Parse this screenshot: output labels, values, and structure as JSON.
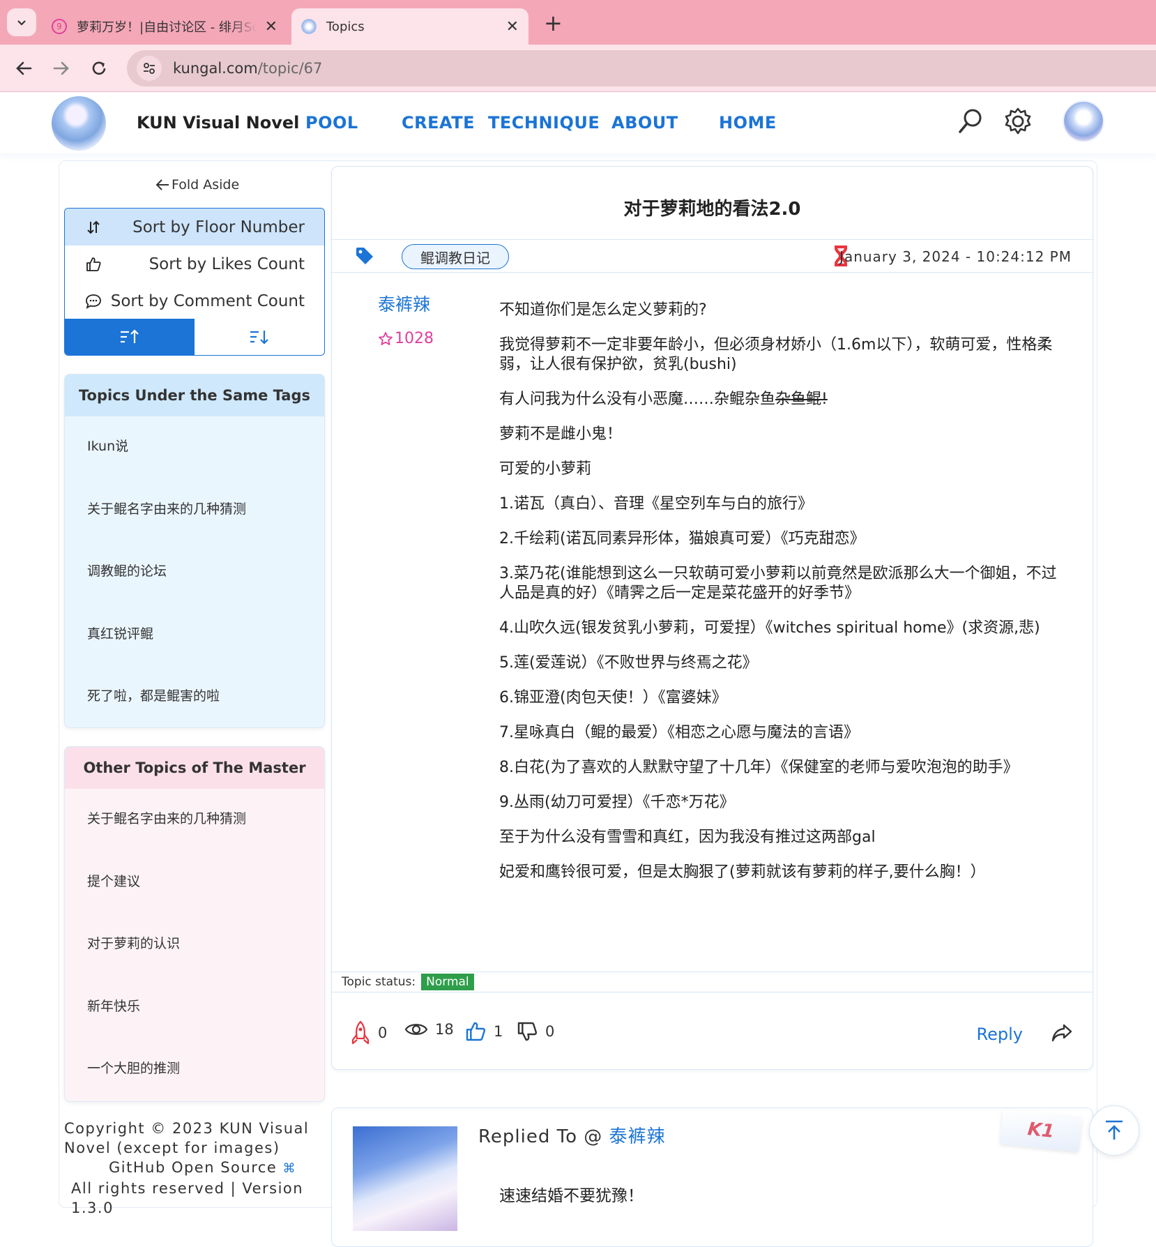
{
  "browser": {
    "tabs": [
      {
        "title": "萝莉万岁！|自由讨论区 - 绯月Sc",
        "favicon": "pink-circle-icon",
        "active": false
      },
      {
        "title": "Topics",
        "favicon": "kun-icon",
        "active": true
      }
    ],
    "url_host": "kungal.com",
    "url_path": "/topic/67"
  },
  "header": {
    "brand": "KUN Visual Novel",
    "menu": [
      "POOL",
      "CREATE",
      "TECHNIQUE",
      "ABOUT",
      "HOME"
    ]
  },
  "aside": {
    "fold_label": "Fold Aside",
    "sort_options": [
      {
        "label": "Sort by Floor Number",
        "icon": "sort-arrows-icon",
        "selected": true
      },
      {
        "label": "Sort by Likes Count",
        "icon": "thumbs-up-icon",
        "selected": false
      },
      {
        "label": "Sort by Comment Count",
        "icon": "comment-icon",
        "selected": false
      }
    ],
    "same_tags": {
      "title": "Topics Under the Same Tags",
      "items": [
        "Ikun说",
        "关于鲲名字由来的几种猜测",
        "调教鲲的论坛",
        "真红锐评鲲",
        "死了啦，都是鲲害的啦"
      ]
    },
    "master": {
      "title": "Other Topics of The Master",
      "items": [
        "关于鲲名字由来的几种猜测",
        "提个建议",
        "对于萝莉的认识",
        "新年快乐",
        "一个大胆的推测"
      ]
    },
    "copyright": {
      "line1": "Copyright © 2023 KUN Visual Novel (except for images)",
      "line2": "GitHub Open Source",
      "line3": "All rights reserved | Version 1.3.0"
    }
  },
  "topic": {
    "title": "对于萝莉地的看法2.0",
    "tag": "鲲调教日记",
    "time": "January 3, 2024 - 10:24:12 PM",
    "author": "泰裤辣",
    "moemoepoint": "1028",
    "paragraphs": [
      "不知道你们是怎么定义萝莉的?",
      "我觉得萝莉不一定非要年龄小，但必须身材娇小（1.6m以下），软萌可爱，性格柔弱，让人很有保护欲，贫乳(bushi)",
      "有人问我为什么没有小恶魔……杂鲲杂鱼",
      "萝莉不是雌小鬼！",
      "可爱的小萝莉",
      "1.诺瓦（真白）、音理《星空列车与白的旅行》",
      "2.千绘莉(诺瓦同素异形体，猫娘真可爱）《巧克甜恋》",
      "3.菜乃花(谁能想到这么一只软萌可爱小萝莉以前竟然是欧派那么大一个御姐，不过人品是真的好）《晴霁之后一定是菜花盛开的好季节》",
      "4.山吹久远(银发贫乳小萝莉，可爱捏）《witches spiritual home》(求资源,悲)",
      "5.莲(爱莲说）《不败世界与终焉之花》",
      "6.锦亚澄(肉包天使！）《富婆妹》",
      "7.星咏真白（鲲的最爱）《相恋之心愿与魔法的言语》",
      "8.白花(为了喜欢的人默默守望了十几年）《保健室的老师与爱吹泡泡的助手》",
      "9.丛雨(幼刀可爱捏）《千恋*万花》",
      "至于为什么没有雪雪和真红，因为我没有推过这两部gal",
      "妃爱和鹰铃很可爱，但是太胸狠了(萝莉就该有萝莉的样子,要什么胸！）"
    ],
    "strike_text": "杂鱼鲲!",
    "status_label": "Topic status:",
    "status_value": "Normal",
    "stats": {
      "upvotes": "0",
      "views": "18",
      "likes": "1",
      "dislikes": "0"
    },
    "reply_label": "Reply"
  },
  "reply": {
    "prefix": "Replied To @",
    "to_user": "泰裤辣",
    "content": "速速结婚不要犹豫！",
    "badge": "K1"
  },
  "colors": {
    "accent": "#1b74d6",
    "tabbar": "#f4a7b7",
    "status_green": "#2e9e4a",
    "moemoe": "#e0409c"
  }
}
